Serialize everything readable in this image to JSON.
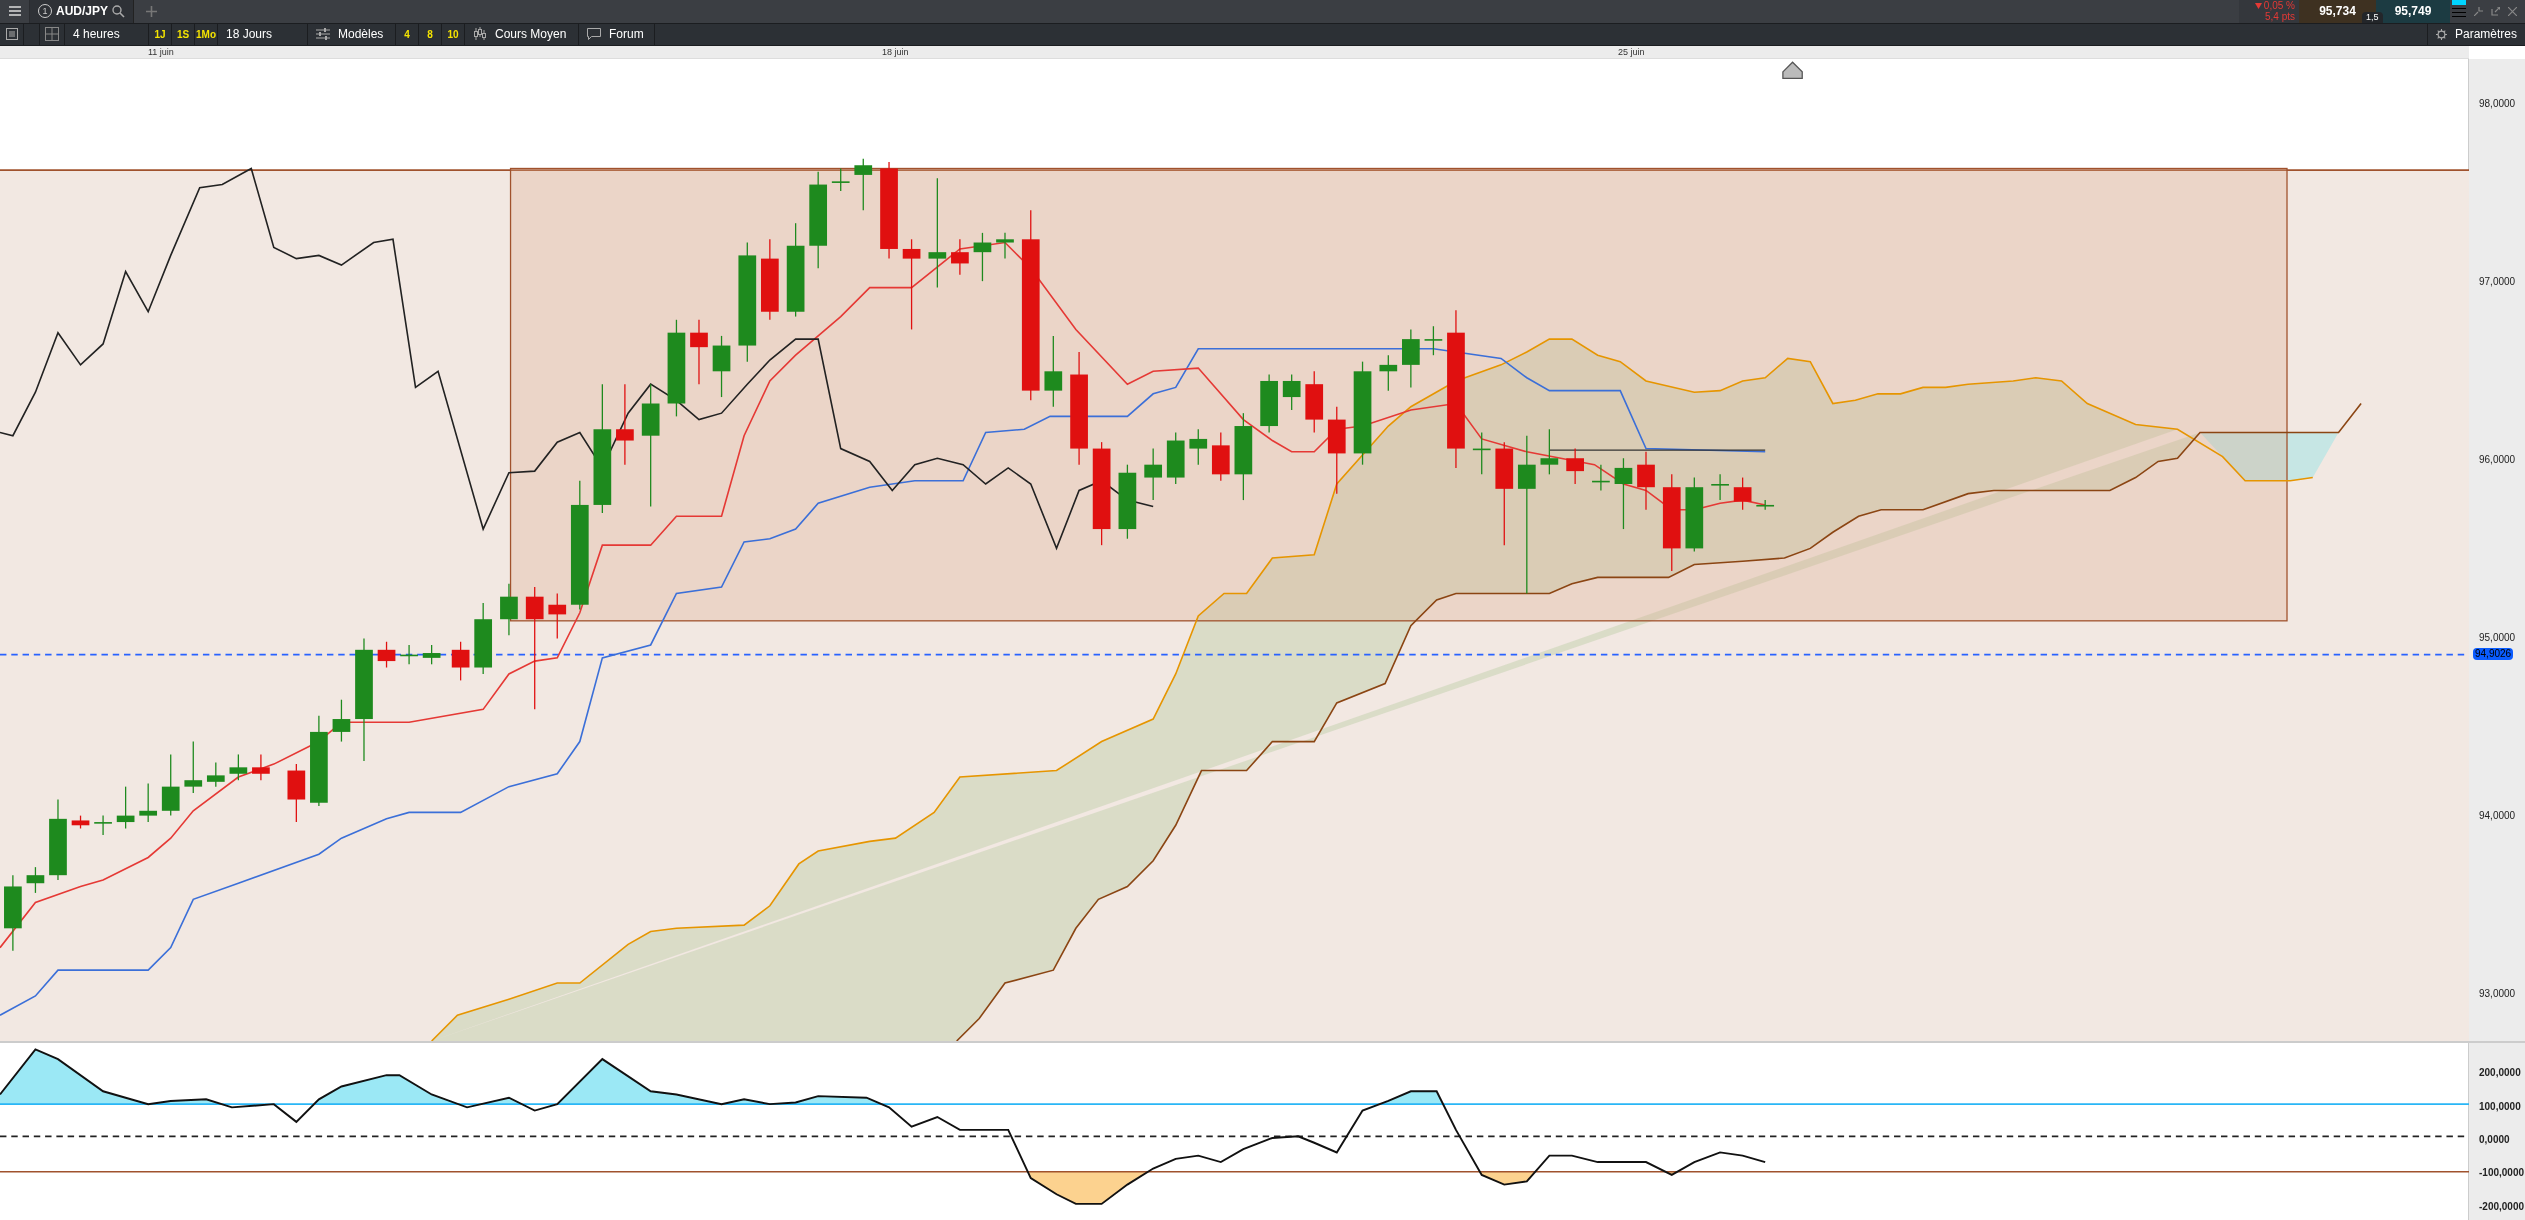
{
  "top_bar": {
    "tab_number": "1",
    "symbol": "AUD/JPY",
    "change": "0,05 %",
    "change_points": "5,4 pts",
    "bid": "95,734",
    "ask": "95,749",
    "spread": "1,5"
  },
  "toolbar": {
    "period": "4 heures",
    "ranges": [
      {
        "label": "1J"
      },
      {
        "label": "1S"
      },
      {
        "label": "1Mo"
      }
    ],
    "span": "18 Jours",
    "templates": "Modèles",
    "template_counts": [
      {
        "label": "4"
      },
      {
        "label": "8"
      },
      {
        "label": "10"
      }
    ],
    "chart_type": "Cours Moyen",
    "forum": "Forum",
    "settings": "Paramètres"
  },
  "date_axis": [
    "11 juin",
    "18 juin",
    "25 juin"
  ],
  "price_axis": {
    "ticks": [
      "98,0000",
      "97,0000",
      "96,0000",
      "95,0000",
      "94,0000",
      "93,0000"
    ],
    "current_price": "94,9026"
  },
  "indicator_axis": [
    "200,0000",
    "100,0000",
    "0,0000",
    "-100,0000",
    "-200,0000"
  ]
}
